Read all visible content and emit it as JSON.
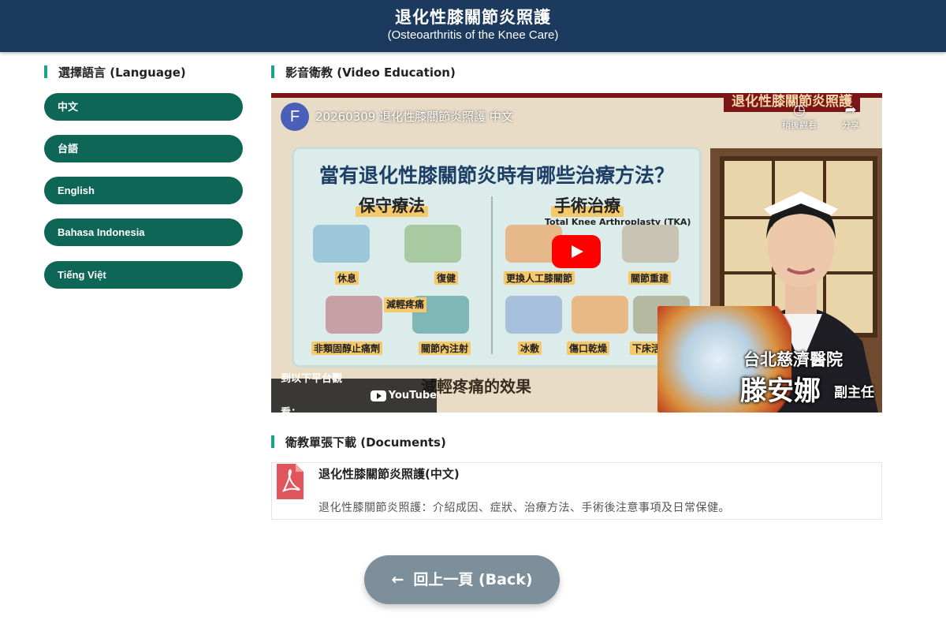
{
  "header": {
    "title": "退化性膝關節炎照護",
    "subtitle": "(Osteoarthritis of the Knee Care)"
  },
  "language_section": {
    "heading": "選擇語言 (Language)",
    "options": [
      "中文",
      "台語",
      "English",
      "Bahasa Indonesia",
      "Tiếng Việt"
    ]
  },
  "video_section": {
    "heading": "影音衛教 (Video Education)",
    "video": {
      "channel_initial": "F",
      "title": "20260309 退化性膝關節炎照護 中文",
      "watch_later": "稍後觀看",
      "share": "分享",
      "watch_on": "到以下平台觀看：",
      "youtube": "YouTube",
      "thumbnail": {
        "top_banner": "退化性膝關節炎照護",
        "headline": "當有退化性膝關節炎時有哪些治療方法？",
        "col_left": "保守療法",
        "col_right": "手術治療",
        "tka": "Total Knee Arthroplasty (TKA)",
        "items": [
          "休息",
          "復健",
          "非類固醇止痛劑",
          "關節內注射",
          "更換人工膝關節",
          "關節重建",
          "冰敷",
          "傷口乾燥",
          "下床活動"
        ],
        "relief_tag": "減輕疼痛",
        "subtitle_line": "減輕疼痛的效果",
        "hospital": "台北慈濟醫院",
        "doctor": "滕安娜",
        "doctor_title": "副主任"
      }
    }
  },
  "documents_section": {
    "heading": "衛教單張下載 (Documents)",
    "items": [
      {
        "title": "退化性膝關節炎照護(中文)",
        "description": "退化性膝關節炎照護：介紹成因、症狀、治療方法、手術後注意事項及日常保健。"
      }
    ]
  },
  "back_button": {
    "arrow": "←",
    "label": "回上一頁 (Back)"
  },
  "colors": {
    "header_bg": "#1c3a5e",
    "accent_bar": "#1aa38c",
    "language_button": "#0e6657",
    "back_button": "#7d8f9a",
    "pdf_icon": "#e0565c"
  }
}
